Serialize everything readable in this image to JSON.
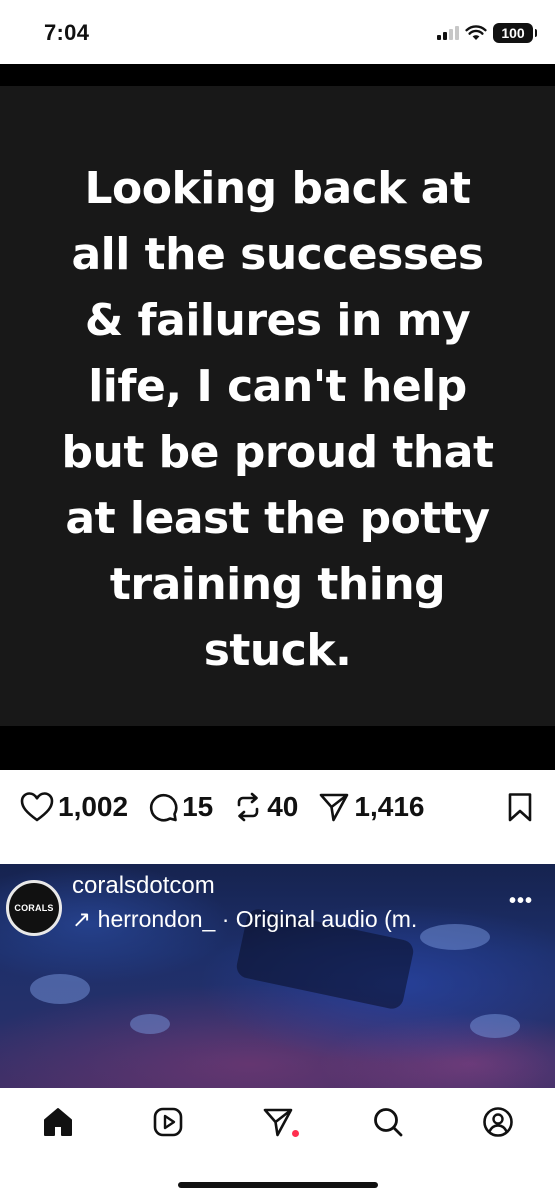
{
  "status_bar": {
    "time": "7:04",
    "battery": "100"
  },
  "post": {
    "meme_text": "Looking back at\nall the successes\n& failures in my\nlife, I can't help\nbut be proud that\nat least the potty\ntraining thing\nstuck.",
    "likes": "1,002",
    "comments": "15",
    "reposts": "40",
    "shares": "1,416"
  },
  "next_post": {
    "avatar_text": "CORALS",
    "username": "coralsdotcom",
    "audio_prefix": "↗",
    "audio_text": "herrondon_ · Original audio (m."
  },
  "icons": {
    "like": "heart-icon",
    "comment": "comment-icon",
    "repost": "repost-icon",
    "share": "send-icon",
    "bookmark": "bookmark-icon",
    "more": "more-icon",
    "home": "home-icon",
    "reels": "reels-icon",
    "messages": "send-icon",
    "search": "search-icon",
    "profile": "profile-icon"
  },
  "colors": {
    "notification_dot": "#ff2f4f",
    "meme_background": "#181818"
  }
}
